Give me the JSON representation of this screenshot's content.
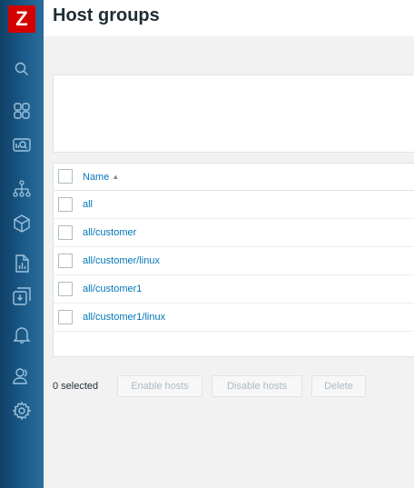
{
  "logo": {
    "letter": "Z"
  },
  "sidebar": {
    "icons": [
      "search-icon",
      "dashboard-icon",
      "monitoring-icon",
      "network-icon",
      "inventory-icon",
      "reports-icon",
      "data-collection-icon",
      "alerts-icon",
      "users-icon",
      "settings-icon"
    ]
  },
  "page": {
    "title": "Host groups"
  },
  "table": {
    "header": {
      "name": "Name",
      "sort_indicator": "▲"
    },
    "rows": [
      {
        "name": "all"
      },
      {
        "name": "all/customer"
      },
      {
        "name": "all/customer/linux"
      },
      {
        "name": "all/customer1"
      },
      {
        "name": "all/customer1/linux"
      }
    ]
  },
  "actions": {
    "selected_count": "0 selected",
    "enable_hosts": "Enable hosts",
    "disable_hosts": "Disable hosts",
    "delete": "Delete"
  },
  "colors": {
    "sidebar": "#1b5b8a",
    "logo": "#d40000",
    "link": "#0275b8",
    "background": "#f2f2f2",
    "disabled_text": "#acbbc2"
  }
}
